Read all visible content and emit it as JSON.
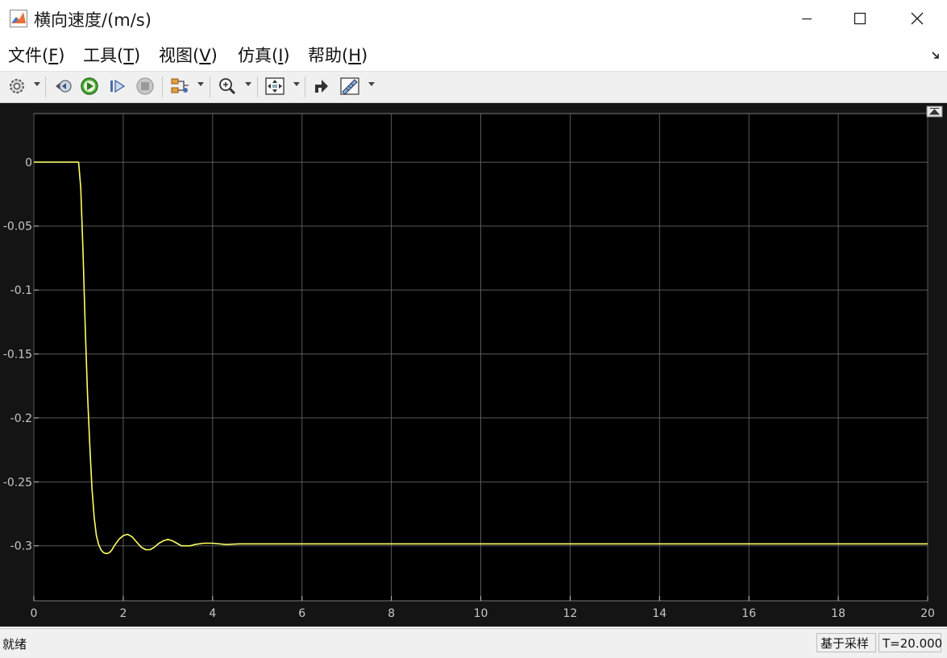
{
  "window": {
    "title": "横向速度/(m/s)"
  },
  "menu": [
    {
      "label": "文件(",
      "key": "F",
      "close": ")"
    },
    {
      "label": "工具(",
      "key": "T",
      "close": ")"
    },
    {
      "label": "视图(",
      "key": "V",
      "close": ")"
    },
    {
      "label": "仿真(",
      "key": "I",
      "close": ")"
    },
    {
      "label": "帮助(",
      "key": "H",
      "close": ")"
    }
  ],
  "toolbar": {
    "icons": [
      "gear-icon",
      "step-back-icon",
      "run-icon",
      "step-forward-icon",
      "stop-icon",
      "signal-select-icon",
      "zoom-icon",
      "fit-icon",
      "restore-icon",
      "measure-icon"
    ]
  },
  "status": {
    "ready": "就绪",
    "sample_mode": "基于采样",
    "time": "T=20.000"
  },
  "colors": {
    "plot_bg": "#000000",
    "frame_bg": "#141414",
    "line": "#ffff66",
    "grid": "#5a5a5a",
    "tick_text": "#c8c8c8"
  },
  "chart_data": {
    "type": "line",
    "title": "",
    "xlabel": "",
    "ylabel": "",
    "xlim": [
      0,
      20
    ],
    "ylim": [
      -0.343,
      0.038
    ],
    "xticks": [
      0,
      2,
      4,
      6,
      8,
      10,
      12,
      14,
      16,
      18,
      20
    ],
    "yticks": [
      0,
      -0.05,
      -0.1,
      -0.15,
      -0.2,
      -0.25,
      -0.3
    ],
    "ytick_labels": [
      "0",
      "-0.05",
      "-0.1",
      "-0.15",
      "-0.2",
      "-0.25",
      "-0.3"
    ],
    "grid": true,
    "series": [
      {
        "x": [
          0,
          1.0,
          1.05,
          1.1,
          1.15,
          1.2,
          1.25,
          1.3,
          1.35,
          1.4,
          1.45,
          1.5,
          1.55,
          1.6,
          1.65,
          1.7,
          1.75,
          1.8,
          1.9,
          2.0,
          2.1,
          2.2,
          2.3,
          2.4,
          2.5,
          2.6,
          2.7,
          2.8,
          2.9,
          3.0,
          3.1,
          3.2,
          3.3,
          3.4,
          3.5,
          3.6,
          3.8,
          4.0,
          4.3,
          4.6,
          5.0,
          5.5,
          6.0,
          7.0,
          8.0,
          10.0,
          12.0,
          14.0,
          16.0,
          18.0,
          20.0
        ],
        "y": [
          0,
          0,
          -0.02,
          -0.07,
          -0.13,
          -0.18,
          -0.22,
          -0.255,
          -0.278,
          -0.292,
          -0.299,
          -0.303,
          -0.305,
          -0.306,
          -0.306,
          -0.305,
          -0.303,
          -0.3,
          -0.295,
          -0.292,
          -0.291,
          -0.293,
          -0.297,
          -0.301,
          -0.303,
          -0.303,
          -0.301,
          -0.298,
          -0.296,
          -0.295,
          -0.296,
          -0.298,
          -0.3,
          -0.3,
          -0.3,
          -0.299,
          -0.298,
          -0.298,
          -0.299,
          -0.2985,
          -0.2985,
          -0.2985,
          -0.2985,
          -0.2985,
          -0.2985,
          -0.2985,
          -0.2985,
          -0.2985,
          -0.2985,
          -0.2985,
          -0.2985
        ]
      }
    ]
  }
}
